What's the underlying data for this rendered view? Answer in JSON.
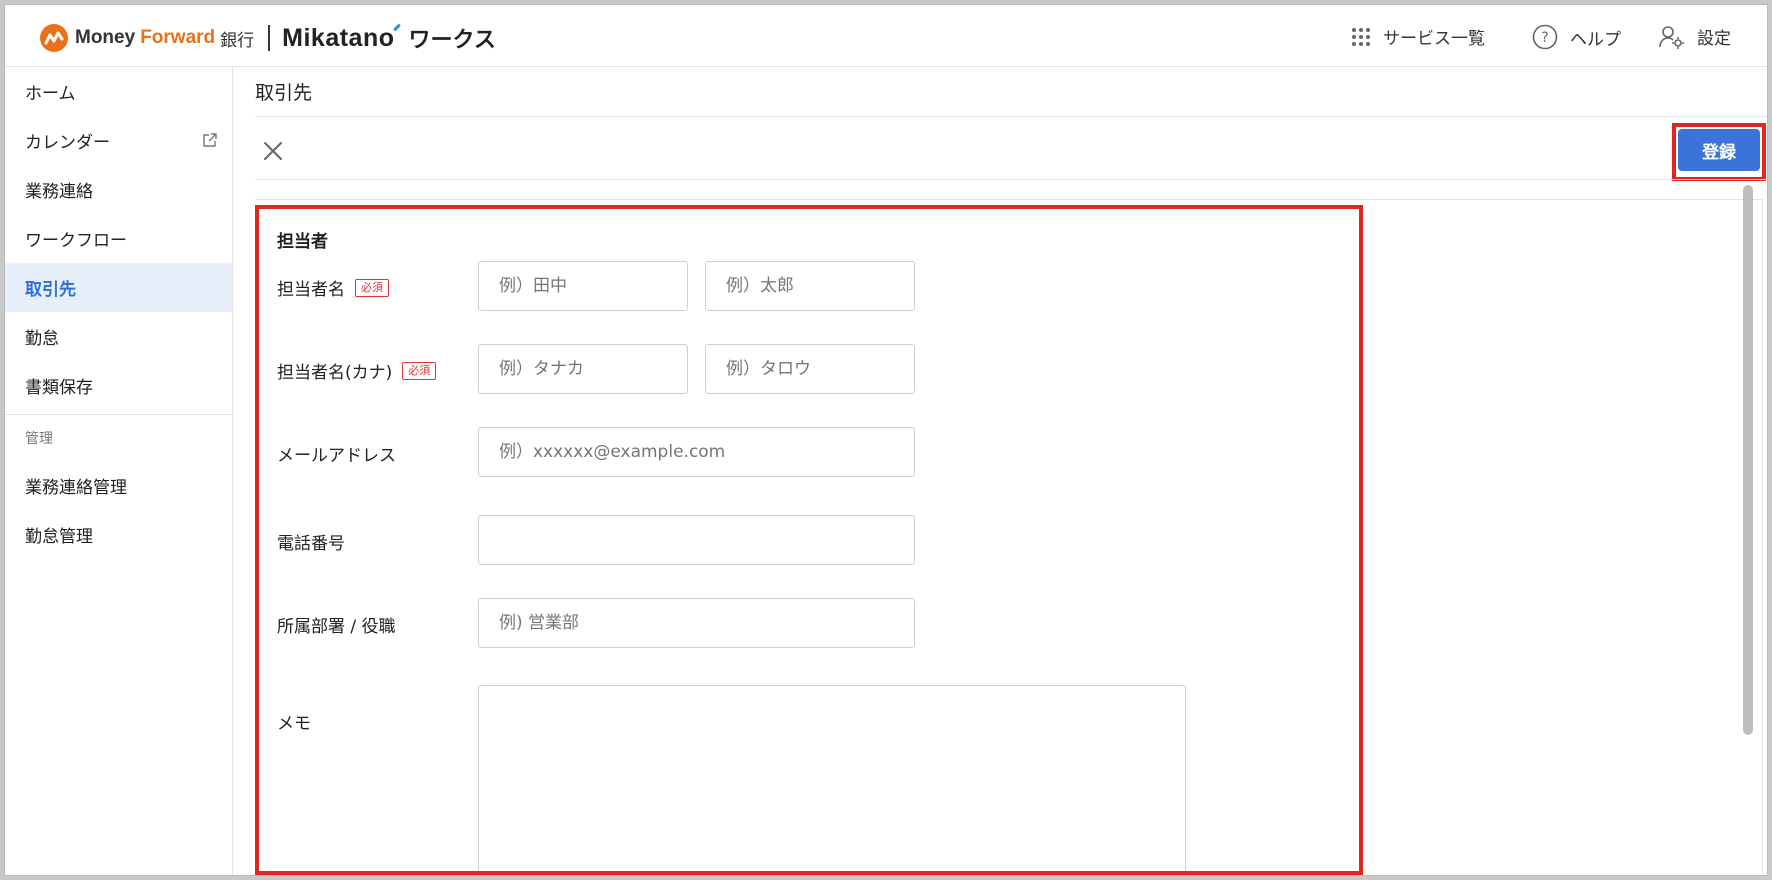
{
  "header": {
    "brand_money": "Money",
    "brand_forward": "Forward",
    "brand_bank": "銀行",
    "brand_product": "Mikatano",
    "brand_works": "ワークス",
    "nav": [
      {
        "label": "サービス一覧",
        "icon": "grid-icon"
      },
      {
        "label": "ヘルプ",
        "icon": "help-icon"
      },
      {
        "label": "設定",
        "icon": "user-settings-icon"
      }
    ]
  },
  "sidebar": {
    "items": [
      {
        "label": "ホーム"
      },
      {
        "label": "カレンダー",
        "icon": "external-link-icon"
      },
      {
        "label": "業務連絡"
      },
      {
        "label": "ワークフロー"
      },
      {
        "label": "取引先",
        "active": true
      },
      {
        "label": "勤怠"
      },
      {
        "label": "書類保存"
      }
    ],
    "section_label": "管理",
    "admin_items": [
      {
        "label": "業務連絡管理"
      },
      {
        "label": "勤怠管理"
      }
    ]
  },
  "main": {
    "title": "取引先",
    "register_label": "登録",
    "form": {
      "section_title": "担当者",
      "required_badge": "必須",
      "fields": {
        "name": {
          "label": "担当者名",
          "last_placeholder": "例）田中",
          "first_placeholder": "例）太郎"
        },
        "kana": {
          "label": "担当者名(カナ)",
          "last_placeholder": "例）タナカ",
          "first_placeholder": "例）タロウ"
        },
        "email": {
          "label": "メールアドレス",
          "placeholder": "例）xxxxxx@example.com"
        },
        "phone": {
          "label": "電話番号",
          "placeholder": ""
        },
        "department": {
          "label": "所属部署 / 役職",
          "placeholder": "例) 営業部"
        },
        "memo": {
          "label": "メモ",
          "placeholder": ""
        }
      }
    }
  },
  "colors": {
    "accent": "#3a73d9",
    "forward_orange": "#e8711a",
    "highlight_red": "#e0261e",
    "active_bg": "#e7effb"
  }
}
